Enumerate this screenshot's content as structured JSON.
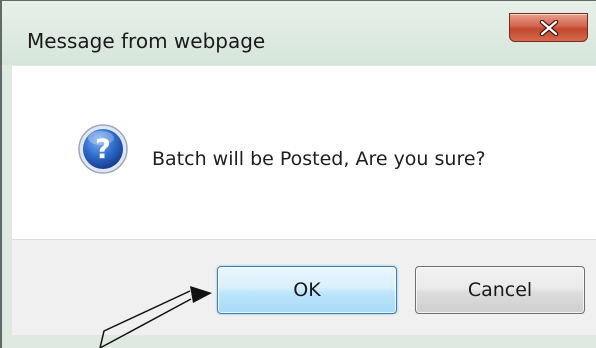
{
  "window": {
    "title": "Message from webpage",
    "close_symbol": "x",
    "close_icon": "close-icon"
  },
  "content": {
    "icon": "question-icon",
    "icon_glyph": "?",
    "message": "Batch will be Posted, Are you sure?"
  },
  "buttons": {
    "ok_label": "OK",
    "cancel_label": "Cancel"
  },
  "annotation": {
    "type": "pointer-arrow",
    "target": "ok-button"
  },
  "colors": {
    "titlebar": "#dde9e1",
    "close_button": "#c7503a",
    "icon_blue": "#2a63c4",
    "ok_border": "#3c7fb1",
    "footer": "#f0f0f0"
  }
}
